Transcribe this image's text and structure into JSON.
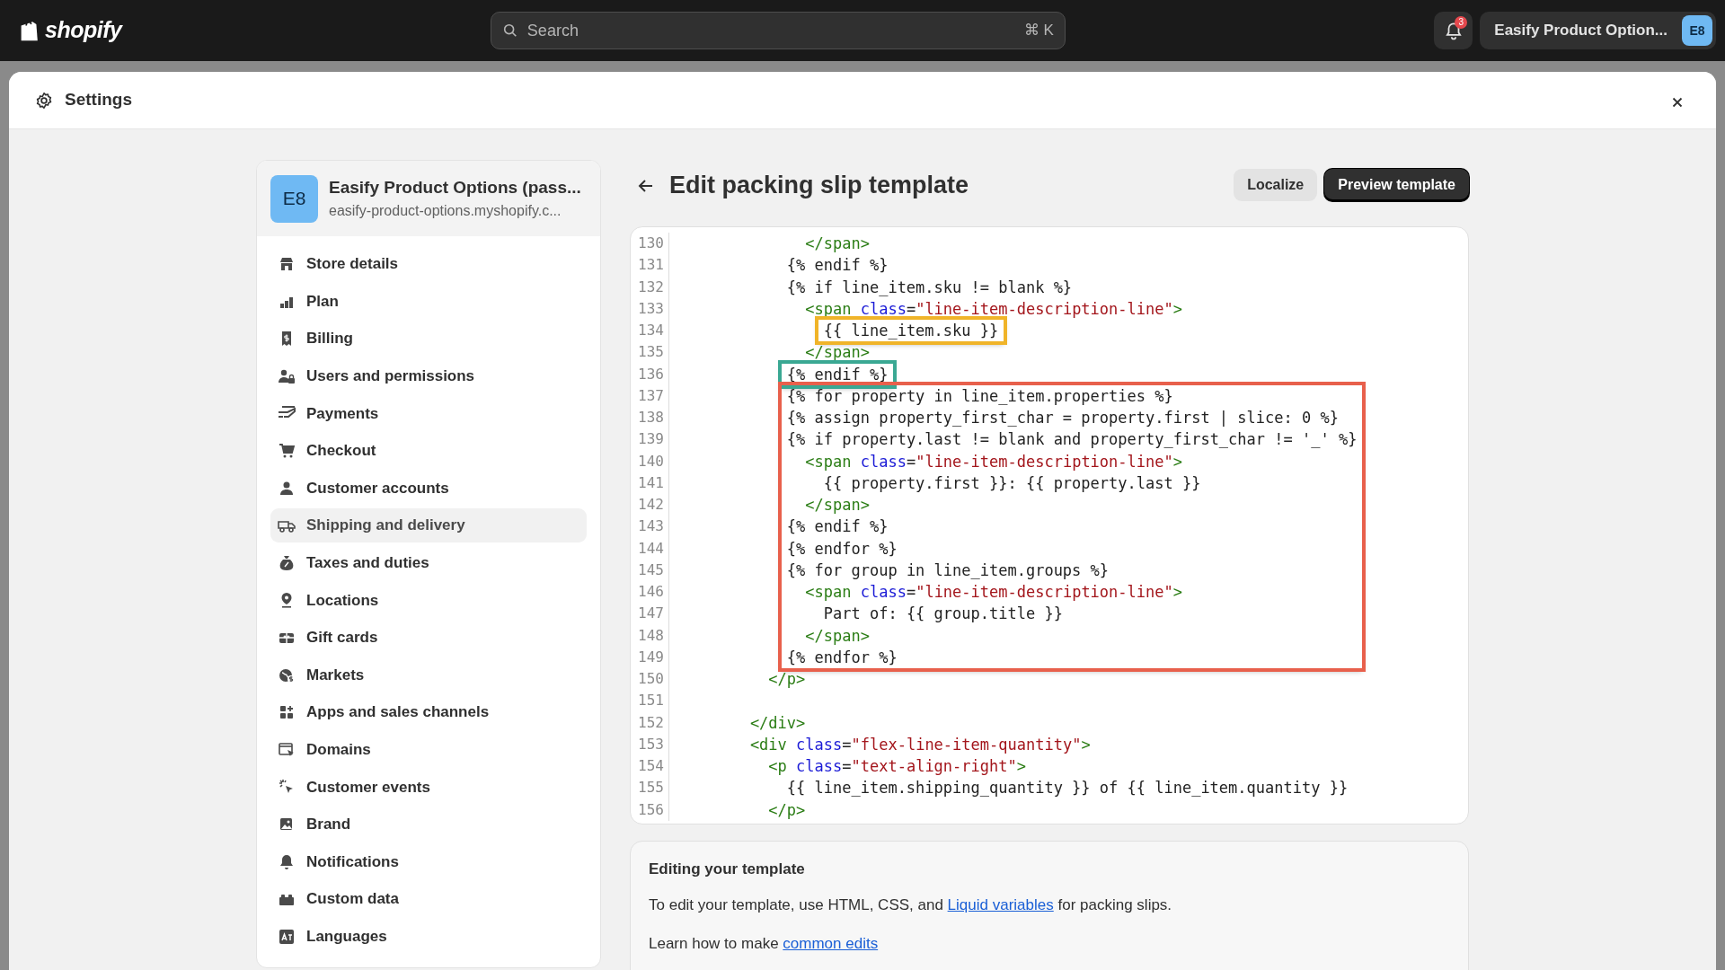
{
  "topbar": {
    "logo_text": "shopify",
    "search": {
      "placeholder": "Search",
      "shortcut": "⌘ K"
    },
    "notifications": {
      "count": "3"
    },
    "store": {
      "name": "Easify Product Option...",
      "initials": "E8"
    }
  },
  "settings": {
    "title": "Settings"
  },
  "store_card": {
    "initials": "E8",
    "name": "Easify Product Options (pass...",
    "domain": "easify-product-options.myshopify.c..."
  },
  "sidebar": {
    "items": [
      {
        "label": "Store details",
        "selected": false
      },
      {
        "label": "Plan",
        "selected": false
      },
      {
        "label": "Billing",
        "selected": false
      },
      {
        "label": "Users and permissions",
        "selected": false
      },
      {
        "label": "Payments",
        "selected": false
      },
      {
        "label": "Checkout",
        "selected": false
      },
      {
        "label": "Customer accounts",
        "selected": false
      },
      {
        "label": "Shipping and delivery",
        "selected": true
      },
      {
        "label": "Taxes and duties",
        "selected": false
      },
      {
        "label": "Locations",
        "selected": false
      },
      {
        "label": "Gift cards",
        "selected": false
      },
      {
        "label": "Markets",
        "selected": false
      },
      {
        "label": "Apps and sales channels",
        "selected": false
      },
      {
        "label": "Domains",
        "selected": false
      },
      {
        "label": "Customer events",
        "selected": false
      },
      {
        "label": "Brand",
        "selected": false
      },
      {
        "label": "Notifications",
        "selected": false
      },
      {
        "label": "Custom data",
        "selected": false
      },
      {
        "label": "Languages",
        "selected": false
      }
    ]
  },
  "page": {
    "title": "Edit packing slip template",
    "buttons": [
      {
        "label": "Localize",
        "kind": "secondary"
      },
      {
        "label": "Preview template",
        "kind": "primary"
      }
    ]
  },
  "code": {
    "blocks": [
      {
        "kind": "line",
        "n": "130",
        "tokens": [
          {
            "kind": "tag",
            "text": "              </span>"
          }
        ]
      },
      {
        "kind": "line",
        "n": "131",
        "tokens": [
          {
            "kind": "plain",
            "text": "            {% endif %}"
          }
        ]
      },
      {
        "kind": "line",
        "n": "132",
        "tokens": [
          {
            "kind": "plain",
            "text": "            {% if line_item.sku != blank %}"
          }
        ]
      },
      {
        "kind": "line",
        "n": "133",
        "tokens": [
          {
            "kind": "tag",
            "text": "              <span "
          },
          {
            "kind": "attr",
            "text": "class"
          },
          {
            "kind": "plain",
            "text": "="
          },
          {
            "kind": "string",
            "text": "\"line-item-description-line\""
          },
          {
            "kind": "tag",
            "text": ">"
          }
        ]
      },
      {
        "kind": "highlight",
        "color": "#f0b429",
        "lines": [
          {
            "n": "134",
            "tokens": [
              {
                "kind": "plain",
                "text": "                {{ line_item.sku }}"
              }
            ]
          }
        ]
      },
      {
        "kind": "line",
        "n": "135",
        "tokens": [
          {
            "kind": "tag",
            "text": "              </span>"
          }
        ]
      },
      {
        "kind": "highlight",
        "color": "#3aa893",
        "lines": [
          {
            "n": "136",
            "tokens": [
              {
                "kind": "plain",
                "text": "            {% endif %}"
              }
            ]
          }
        ]
      },
      {
        "kind": "highlight",
        "color": "#e8604c",
        "lines": [
          {
            "n": "137",
            "tokens": [
              {
                "kind": "plain",
                "text": "            {% for property in line_item.properties %}"
              }
            ]
          },
          {
            "n": "138",
            "tokens": [
              {
                "kind": "plain",
                "text": "            {% assign property_first_char = property.first | slice: 0 %}"
              }
            ]
          },
          {
            "n": "139",
            "tokens": [
              {
                "kind": "plain",
                "text": "            {% if property.last != blank and property_first_char != '_' %}"
              }
            ]
          },
          {
            "n": "140",
            "tokens": [
              {
                "kind": "tag",
                "text": "              <span "
              },
              {
                "kind": "attr",
                "text": "class"
              },
              {
                "kind": "plain",
                "text": "="
              },
              {
                "kind": "string",
                "text": "\"line-item-description-line\""
              },
              {
                "kind": "tag",
                "text": ">"
              }
            ]
          },
          {
            "n": "141",
            "tokens": [
              {
                "kind": "plain",
                "text": "                {{ property.first }}: {{ property.last }}"
              }
            ]
          },
          {
            "n": "142",
            "tokens": [
              {
                "kind": "tag",
                "text": "              </span>"
              }
            ]
          },
          {
            "n": "143",
            "tokens": [
              {
                "kind": "plain",
                "text": "            {% endif %}"
              }
            ]
          },
          {
            "n": "144",
            "tokens": [
              {
                "kind": "plain",
                "text": "            {% endfor %}"
              }
            ]
          },
          {
            "n": "145",
            "tokens": [
              {
                "kind": "plain",
                "text": "            {% for group in line_item.groups %}"
              }
            ]
          },
          {
            "n": "146",
            "tokens": [
              {
                "kind": "tag",
                "text": "              <span "
              },
              {
                "kind": "attr",
                "text": "class"
              },
              {
                "kind": "plain",
                "text": "="
              },
              {
                "kind": "string",
                "text": "\"line-item-description-line\""
              },
              {
                "kind": "tag",
                "text": ">"
              }
            ]
          },
          {
            "n": "147",
            "tokens": [
              {
                "kind": "plain",
                "text": "                Part of: {{ group.title }}"
              }
            ]
          },
          {
            "n": "148",
            "tokens": [
              {
                "kind": "tag",
                "text": "              </span>"
              }
            ]
          },
          {
            "n": "149",
            "tokens": [
              {
                "kind": "plain",
                "text": "            {% endfor %}"
              }
            ]
          }
        ]
      },
      {
        "kind": "line",
        "n": "150",
        "tokens": [
          {
            "kind": "tag",
            "text": "          </p>"
          }
        ]
      },
      {
        "kind": "line",
        "n": "151"
      },
      {
        "kind": "line",
        "n": "152",
        "tokens": [
          {
            "kind": "tag",
            "text": "        </div>"
          }
        ]
      },
      {
        "kind": "line",
        "n": "153",
        "tokens": [
          {
            "kind": "tag",
            "text": "        <div "
          },
          {
            "kind": "attr",
            "text": "class"
          },
          {
            "kind": "plain",
            "text": "="
          },
          {
            "kind": "string",
            "text": "\"flex-line-item-quantity\""
          },
          {
            "kind": "tag",
            "text": ">"
          }
        ]
      },
      {
        "kind": "line",
        "n": "154",
        "tokens": [
          {
            "kind": "tag",
            "text": "          <p "
          },
          {
            "kind": "attr",
            "text": "class"
          },
          {
            "kind": "plain",
            "text": "="
          },
          {
            "kind": "string",
            "text": "\"text-align-right\""
          },
          {
            "kind": "tag",
            "text": ">"
          }
        ]
      },
      {
        "kind": "line",
        "n": "155",
        "tokens": [
          {
            "kind": "plain",
            "text": "            {{ line_item.shipping_quantity }} of {{ line_item.quantity }}"
          }
        ]
      },
      {
        "kind": "line",
        "n": "156",
        "tokens": [
          {
            "kind": "tag",
            "text": "          </p>"
          }
        ]
      }
    ]
  },
  "help": {
    "title": "Editing your template",
    "paragraphs": [
      {
        "before": "To edit your template, use HTML, CSS, and ",
        "link": "Liquid variables",
        "after": " for packing slips."
      },
      {
        "before": "Learn how to make ",
        "link": "common edits"
      }
    ]
  }
}
